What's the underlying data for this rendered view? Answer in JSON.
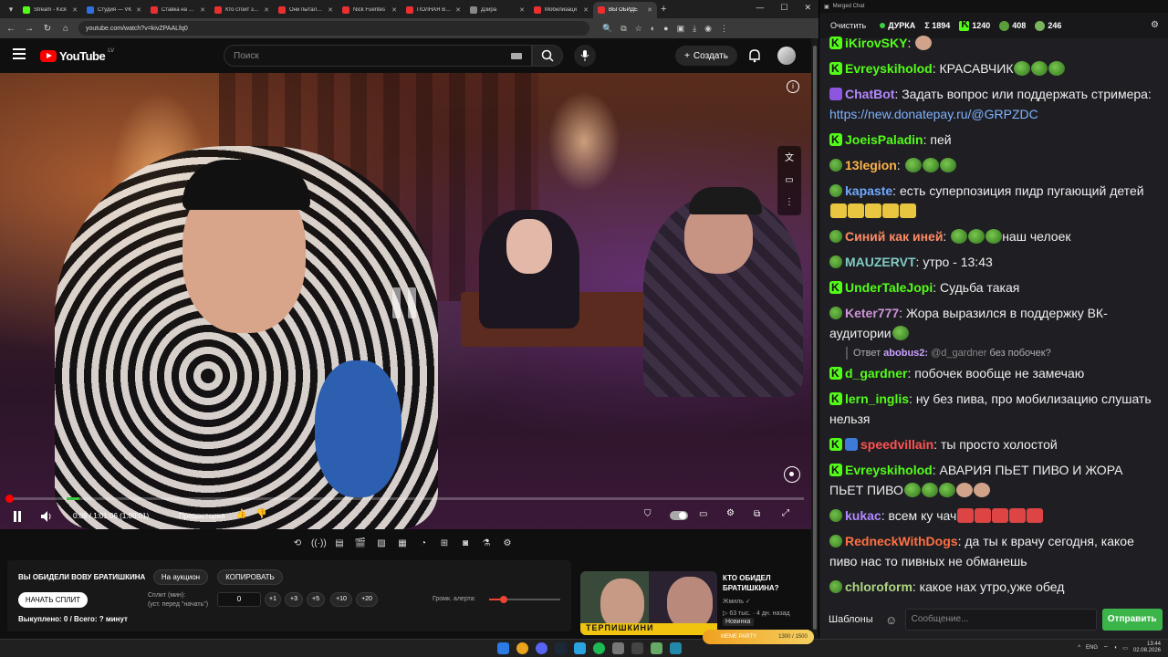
{
  "browser": {
    "tabs": [
      {
        "label": "Stream - Kick",
        "color": "#53fc18"
      },
      {
        "label": "Студия — VK",
        "color": "#2f6fe0"
      },
      {
        "label": "Ставка на выс",
        "color": "#e83030"
      },
      {
        "label": "Кто стоит за з",
        "color": "#e83030"
      },
      {
        "label": "Они пытались",
        "color": "#e83030"
      },
      {
        "label": "Nick Fuentes",
        "color": "#e83030"
      },
      {
        "label": "ПОЛНАЯ ВСЕЛ",
        "color": "#e83030"
      },
      {
        "label": "Дзира",
        "color": "#888888"
      },
      {
        "label": "Мобилизаци",
        "color": "#e83030"
      },
      {
        "label": "ВЫ ОБИДЕ",
        "color": "#e83030"
      }
    ],
    "url": "youtube.com/watch?v=kivZPAALfq0"
  },
  "youtube": {
    "region": "LV",
    "brand": "YouTube",
    "search_placeholder": "Поиск",
    "create_label": "Создать"
  },
  "player": {
    "time": "0:08 / 1:01:06 (1:00:01)",
    "chapter": "Предыстория",
    "progress_fraction": 0.0022
  },
  "auction": {
    "title": "ВЫ ОБИДЕЛИ ВОВУ БРАТИШКИНА",
    "on_auction": "На аукцион",
    "copy": "КОПИРОВАТЬ",
    "start_split": "НАЧАТЬ СПЛИТ",
    "split_label": "Сплит (мин):",
    "split_hint": "(уст. перед \"начать\")",
    "split_value": "0",
    "increments": [
      "+1",
      "+3",
      "+5",
      "+10",
      "+20"
    ],
    "bought": "Выкуплено: 0 / Всего: ? минут",
    "alert_label": "Громк. алерта:",
    "alert_volume": 0.2
  },
  "recommendation": {
    "title": "КТО ОБИДЕЛ БРАТИШКИНА?",
    "channel": "Жмиль",
    "views": "63 тыс.",
    "age": "4 дн. назад",
    "badge": "Новинка",
    "thumb_caption": "ТЕРПИШКИНИ"
  },
  "chat": {
    "window_title": "Merged Chat",
    "clear": "Очистить",
    "status": "ДУРКА",
    "stats": [
      {
        "icon": "sigma",
        "value": "Σ 1894"
      },
      {
        "icon": "kick",
        "value": "1240"
      },
      {
        "icon": "twitch",
        "value": "408"
      },
      {
        "icon": "vk",
        "value": "246"
      }
    ],
    "templates": "Шаблоны",
    "input_placeholder": "Сообщение...",
    "send": "Отправить",
    "messages": [
      {
        "badge": "kick",
        "user": "iKirovSKY",
        "color": "#53fc18",
        "text": ""
      },
      {
        "badge": "kick",
        "user": "Evreyskiholod",
        "color": "#53fc18",
        "text": "КРАСАВЧИК"
      },
      {
        "badge": "bot",
        "user": "ChatBot",
        "color": "#b388ff",
        "text": "Задать вопрос или поддержать стримера: ",
        "link": "https://new.donatepay.ru/@GRPZDC"
      },
      {
        "badge": "kick",
        "user": "JoeisPaladin",
        "color": "#53fc18",
        "text": "пей"
      },
      {
        "badge": "pepe",
        "user": "13legion",
        "color": "#ffb347",
        "text": ""
      },
      {
        "badge": "pepe",
        "user": "kapaste",
        "color": "#6fa8ff",
        "text": "есть суперпозиция пидр пугающий детей"
      },
      {
        "badge": "pepe",
        "user": "Синий как иней",
        "color": "#ff8a65",
        "text": "наш челоек"
      },
      {
        "badge": "pepe",
        "user": "MAUZERVT",
        "color": "#80cbc4",
        "text": "утро - 13:43"
      },
      {
        "badge": "kick",
        "user": "UnderTaleJopi",
        "color": "#53fc18",
        "text": "Судьба такая"
      },
      {
        "badge": "pepe",
        "user": "Keter777",
        "color": "#ce93d8",
        "text": "Жора выразился в поддержку ВК-аудитории"
      },
      {
        "badge": "kick",
        "user": "d_gardner",
        "color": "#53fc18",
        "text": "побочек вообще не замечаю",
        "reply": {
          "prefix": "Ответ",
          "user": "abobus2:",
          "mention": "@d_gardner",
          "text": "без побочек?"
        }
      },
      {
        "badge": "kick",
        "user": "lern_inglis",
        "color": "#53fc18",
        "text": "ну без пива, про мобилизацию слушать нельзя"
      },
      {
        "badge": "kick",
        "user": "speedvillain",
        "color": "#ff5252",
        "text": "ты просто холостой"
      },
      {
        "badge": "kick",
        "user": "Evreyskiholod",
        "color": "#53fc18",
        "text": "АВАРИЯ ПЬЕТ ПИВО И ЖОРА ПЬЕТ ПИВО"
      },
      {
        "badge": "pepe",
        "user": "kukac",
        "color": "#b388ff",
        "text": "всем ку чач"
      },
      {
        "badge": "pepe",
        "user": "RedneckWithDogs",
        "color": "#ff7043",
        "text": "да ты к врачу сегодня, какое пиво нас то пивных не обманешь"
      },
      {
        "badge": "pepe",
        "user": "chloroform",
        "color": "#aed581",
        "text": "какое нах утро,уже обед"
      }
    ]
  },
  "taskbar": {
    "media_pill": "MEME PARTY",
    "media_time": "1300 / 1500",
    "lang": "ENG",
    "time": "13:44",
    "date": "02.08.2026"
  }
}
